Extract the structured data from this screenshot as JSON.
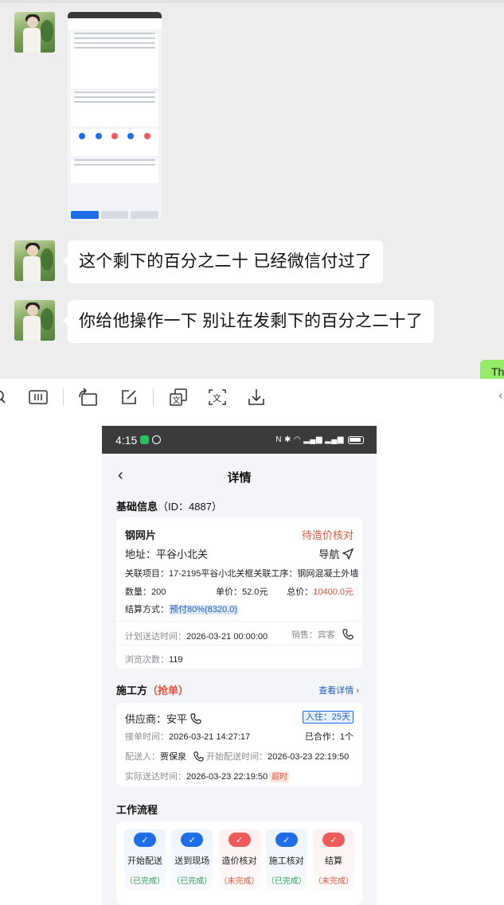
{
  "chat": {
    "messages": [
      {
        "text": "这个剩下的百分之二十 已经微信付过了"
      },
      {
        "text": "你给他操作一下 别让在发剩下的百分之二十了"
      }
    ],
    "outgoing_partial": "Th"
  },
  "toolbar": {
    "icons": [
      "search-icon",
      "text-extract-icon",
      "rotate-icon",
      "edit-icon",
      "translate-icon",
      "text-recognize-icon",
      "download-icon"
    ]
  },
  "phone": {
    "status": {
      "time": "4:15"
    },
    "nav": {
      "back": "‹",
      "title": "详情"
    },
    "basic": {
      "title": "基础信息",
      "id_text": "（ID：4887）",
      "product": "钢网片",
      "status": "待造价核对",
      "address_label": "地址：",
      "address": "平谷小北关",
      "navigate": "导航",
      "project_label": "关联项目：",
      "project": "17-2195平谷小北关框关联工序：钢网混凝土外墙",
      "qty_label": "数量：",
      "qty": "200",
      "price_label": "单价：",
      "price": "52.0元",
      "total_label": "总价：",
      "total": "10400.0元",
      "settle_label": "结算方式：",
      "settle": "预付80%(8320.0)",
      "plan_label": "计划送达时间：",
      "plan_time": "2026-03-21 00:00:00",
      "sales_label": "销售：",
      "sales": "宾客",
      "views_label": "浏览次数：",
      "views": "119"
    },
    "construction": {
      "title": "施工方",
      "tag": "（抢单）",
      "link": "查看详情 ›",
      "supplier_label": "供应商：",
      "supplier": "安平",
      "stay_tag": "入住：25天",
      "accept_label": "接单时间：",
      "accept_time": "2026-03-21 14:27:17",
      "coop_label": "已合作：",
      "coop": "1个",
      "courier_label": "配送人：",
      "courier": "贾保泉",
      "start_label": "开始配送时间：",
      "start_time": "2026-03-23 22:19:50",
      "actual_label": "实际送达时间：",
      "actual_time": "2026-03-23 22:19:50",
      "overtime": "超时"
    },
    "workflow": {
      "title": "工作流程",
      "steps": [
        {
          "name": "开始配送",
          "state": "（已完成）"
        },
        {
          "name": "送到现场",
          "state": "（已完成）"
        },
        {
          "name": "造价核对",
          "state": "（未完成）"
        },
        {
          "name": "施工核对",
          "state": "（已完成）"
        },
        {
          "name": "结算",
          "state": "（未完成）"
        }
      ]
    }
  },
  "colors": {
    "accent": "#1f6ee8",
    "warning": "#e2533a",
    "success": "#2e9e57",
    "chat_bg": "#ededed",
    "bubble_green": "#95ec69"
  }
}
